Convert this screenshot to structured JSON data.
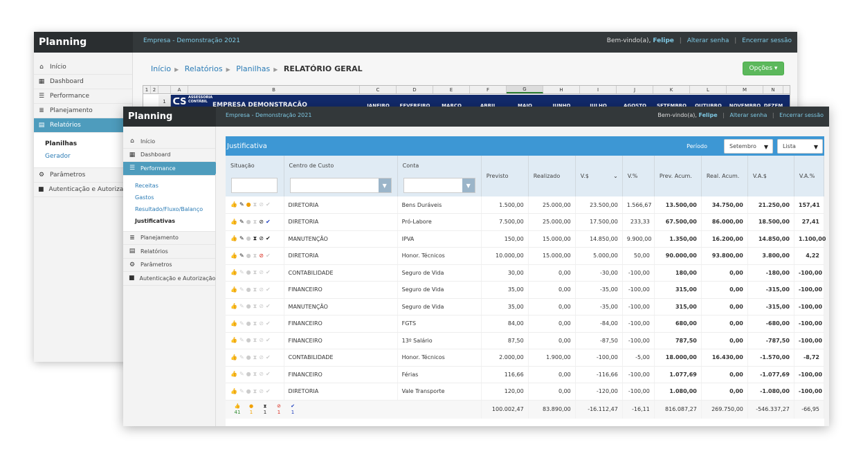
{
  "back": {
    "brand": "Planning",
    "company": "Empresa - Demonstração 2021",
    "welcome": "Bem-vindo(a),",
    "user": "Felipe",
    "change_password": "Alterar senha",
    "sep": "|",
    "logout": "Encerrar sessão",
    "nav": [
      {
        "label": "Início",
        "icon": "home-icon"
      },
      {
        "label": "Dashboard",
        "icon": "grid-icon"
      },
      {
        "label": "Performance",
        "icon": "list-icon"
      },
      {
        "label": "Planejamento",
        "icon": "list-icon"
      },
      {
        "label": "Relatórios",
        "icon": "report-icon"
      }
    ],
    "sub": [
      "Planilhas",
      "Gerador"
    ],
    "nav2": [
      {
        "label": "Parâmetros",
        "icon": "gear-icon"
      },
      {
        "label": "Autenticação e Autorização",
        "icon": "lock-icon"
      }
    ],
    "breadcrumb": [
      "Início",
      "Relatórios",
      "Planilhas"
    ],
    "breadcrumb_current": "RELATÓRIO GERAL",
    "options_label": "Opções",
    "sheet": {
      "columns": [
        "A",
        "B",
        "C",
        "D",
        "E",
        "F",
        "G",
        "H",
        "I",
        "J",
        "K",
        "L",
        "M",
        "N"
      ],
      "groups": [
        "1",
        "2"
      ],
      "row_number": "1",
      "logo_text": "ASSESSORIA CONTÁBIL",
      "title": "EMPRESA DEMONSTRAÇÃO",
      "months": [
        "JANEIRO",
        "FEVEREIRO",
        "MARÇO",
        "ABRIL",
        "MAIO",
        "JUNHO",
        "JULHO",
        "AGOSTO",
        "SETEMBRO",
        "OUTUBRO",
        "NOVEMBRO",
        "DEZEM"
      ]
    }
  },
  "front": {
    "brand": "Planning",
    "company": "Empresa - Demonstração 2021",
    "welcome": "Bem-vindo(a),",
    "user": "Felipe",
    "change_password": "Alterar senha",
    "sep": "|",
    "logout": "Encerrar sessão",
    "nav": [
      {
        "label": "Início",
        "icon": "home-icon"
      },
      {
        "label": "Dashboard",
        "icon": "grid-icon"
      },
      {
        "label": "Performance",
        "icon": "list-icon"
      }
    ],
    "sub": [
      "Receitas",
      "Gastos",
      "Resultado/Fluxo/Balanço",
      "Justificativas"
    ],
    "nav2": [
      {
        "label": "Planejamento",
        "icon": "list-icon"
      },
      {
        "label": "Relatórios",
        "icon": "report-icon"
      },
      {
        "label": "Parâmetros",
        "icon": "gear-icon"
      },
      {
        "label": "Autenticação e Autorização",
        "icon": "lock-icon"
      }
    ],
    "panel_title": "Justificativa",
    "period_label": "Período",
    "period_value": "Setembro",
    "view_value": "Lista",
    "columns": [
      "Situação",
      "Centro de Custo",
      "Conta",
      "Previsto",
      "Realizado",
      "V.$",
      "V.%",
      "Prev. Acum.",
      "Real. Acum.",
      "V.A.$",
      "V.A.%"
    ],
    "rows": [
      {
        "status": "alert",
        "centro": "DIRETORIA",
        "conta": "Bens Duráveis",
        "previsto": "1.500,00",
        "realizado": "25.000,00",
        "vs": "23.500,00",
        "vp": "1.566,67",
        "prev_acum": "13.500,00",
        "real_acum": "34.750,00",
        "vas": "21.250,00",
        "vap": "157,41"
      },
      {
        "status": "check",
        "centro": "DIRETORIA",
        "conta": "Pró-Labore",
        "previsto": "7.500,00",
        "realizado": "25.000,00",
        "vs": "17.500,00",
        "vp": "233,33",
        "prev_acum": "67.500,00",
        "real_acum": "86.000,00",
        "vas": "18.500,00",
        "vap": "27,41"
      },
      {
        "status": "pending",
        "centro": "MANUTENÇÃO",
        "conta": "IPVA",
        "previsto": "150,00",
        "realizado": "15.000,00",
        "vs": "14.850,00",
        "vp": "9.900,00",
        "prev_acum": "1.350,00",
        "real_acum": "16.200,00",
        "vas": "14.850,00",
        "vap": "1.100,00"
      },
      {
        "status": "rejected",
        "centro": "DIRETORIA",
        "conta": "Honor. Técnicos",
        "previsto": "10.000,00",
        "realizado": "15.000,00",
        "vs": "5.000,00",
        "vp": "50,00",
        "prev_acum": "90.000,00",
        "real_acum": "93.800,00",
        "vas": "3.800,00",
        "vap": "4,22"
      },
      {
        "status": "ok",
        "centro": "CONTABILIDADE",
        "conta": "Seguro de Vida",
        "previsto": "30,00",
        "realizado": "0,00",
        "vs": "-30,00",
        "vp": "-100,00",
        "prev_acum": "180,00",
        "real_acum": "0,00",
        "vas": "-180,00",
        "vap": "-100,00"
      },
      {
        "status": "ok",
        "centro": "FINANCEIRO",
        "conta": "Seguro de Vida",
        "previsto": "35,00",
        "realizado": "0,00",
        "vs": "-35,00",
        "vp": "-100,00",
        "prev_acum": "315,00",
        "real_acum": "0,00",
        "vas": "-315,00",
        "vap": "-100,00"
      },
      {
        "status": "ok",
        "centro": "MANUTENÇÃO",
        "conta": "Seguro de Vida",
        "previsto": "35,00",
        "realizado": "0,00",
        "vs": "-35,00",
        "vp": "-100,00",
        "prev_acum": "315,00",
        "real_acum": "0,00",
        "vas": "-315,00",
        "vap": "-100,00"
      },
      {
        "status": "ok",
        "centro": "FINANCEIRO",
        "conta": "FGTS",
        "previsto": "84,00",
        "realizado": "0,00",
        "vs": "-84,00",
        "vp": "-100,00",
        "prev_acum": "680,00",
        "real_acum": "0,00",
        "vas": "-680,00",
        "vap": "-100,00"
      },
      {
        "status": "ok",
        "centro": "FINANCEIRO",
        "conta": "13º Salário",
        "previsto": "87,50",
        "realizado": "0,00",
        "vs": "-87,50",
        "vp": "-100,00",
        "prev_acum": "787,50",
        "real_acum": "0,00",
        "vas": "-787,50",
        "vap": "-100,00"
      },
      {
        "status": "ok",
        "centro": "CONTABILIDADE",
        "conta": "Honor. Técnicos",
        "previsto": "2.000,00",
        "realizado": "1.900,00",
        "vs": "-100,00",
        "vp": "-5,00",
        "prev_acum": "18.000,00",
        "real_acum": "16.430,00",
        "vas": "-1.570,00",
        "vap": "-8,72"
      },
      {
        "status": "ok",
        "centro": "FINANCEIRO",
        "conta": "Férias",
        "previsto": "116,66",
        "realizado": "0,00",
        "vs": "-116,66",
        "vp": "-100,00",
        "prev_acum": "1.077,69",
        "real_acum": "0,00",
        "vas": "-1.077,69",
        "vap": "-100,00"
      },
      {
        "status": "ok",
        "centro": "DIRETORIA",
        "conta": "Vale Transporte",
        "previsto": "120,00",
        "realizado": "0,00",
        "vs": "-120,00",
        "vp": "-100,00",
        "prev_acum": "1.080,00",
        "real_acum": "0,00",
        "vas": "-1.080,00",
        "vap": "-100,00"
      }
    ],
    "counts": {
      "ok": "41",
      "alert": "1",
      "pending": "1",
      "rejected": "1",
      "check": "1"
    },
    "totals": {
      "previsto": "100.002,47",
      "realizado": "83.890,00",
      "vs": "-16.112,47",
      "vp": "-16,11",
      "prev_acum": "816.087,27",
      "real_acum": "269.750,00",
      "vas": "-546.337,27",
      "vap": "-66,95"
    }
  },
  "colors": {
    "topbar": "#33383a",
    "accent": "#3d97d4",
    "nav_active": "#4e9cbd",
    "link": "#2a7bb5",
    "success": "#5cb85c"
  }
}
